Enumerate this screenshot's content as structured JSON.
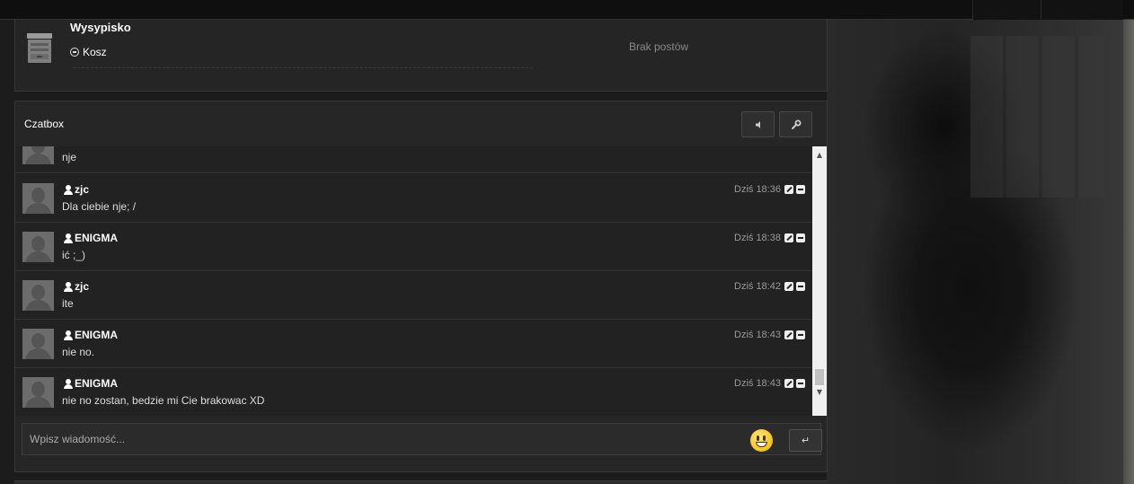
{
  "forum": {
    "title": "Wysypisko",
    "subforum": "Kosz",
    "status": "Brak postów"
  },
  "chatbox": {
    "title": "Czatbox",
    "input_placeholder": "Wpisz wiadomość...",
    "send_label": "↵",
    "partial_message": {
      "text": "nje"
    },
    "messages": [
      {
        "author": "zjc",
        "text": "Dla ciebie nje; /",
        "time": "Dziś 18:36"
      },
      {
        "author": "ENIGMA",
        "text": "ić ;_)",
        "time": "Dziś 18:38"
      },
      {
        "author": "zjc",
        "text": "ite",
        "time": "Dziś 18:42"
      },
      {
        "author": "ENIGMA",
        "text": "nie no.",
        "time": "Dziś 18:43"
      },
      {
        "author": "ENIGMA",
        "text": "nie no zostan, bedzie mi Cie brakowac XD",
        "time": "Dziś 18:43"
      }
    ]
  },
  "icons": {
    "sound": "speaker-icon",
    "settings": "wrench-icon",
    "emoji": "smiley-icon",
    "user": "user-icon",
    "edit": "pencil-icon",
    "delete": "minus-icon",
    "forum": "trash-bin-icon"
  }
}
